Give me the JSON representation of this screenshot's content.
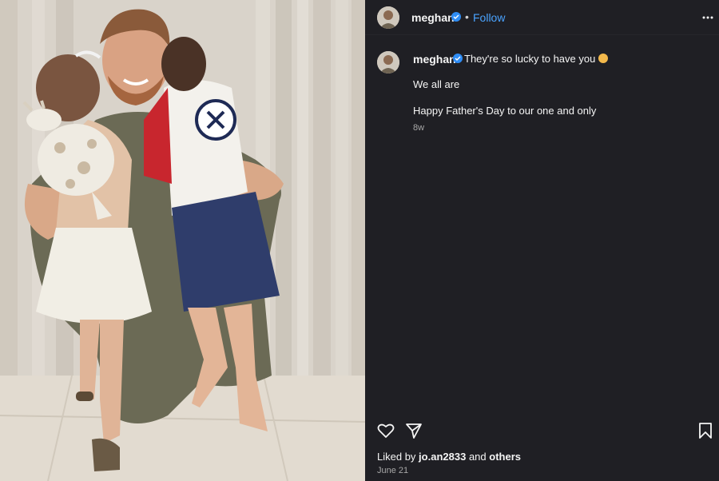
{
  "post": {
    "username": "meghan",
    "follow_label": "Follow",
    "dot_separator": "•",
    "caption_first": "They're so lucky to have you",
    "caption_line_2": "We all are",
    "caption_line_3": "Happy Father's Day to our one and only",
    "age": "8w",
    "liked_by_prefix": "Liked by",
    "liked_by_user": "jo.an2833",
    "liked_by_and": "and",
    "liked_by_others": "others",
    "date": "June 21"
  },
  "colors": {
    "panel_bg": "#1f1f24",
    "link_blue": "#4aa3ff",
    "verified_blue": "#2f8df5"
  },
  "icons": {
    "header_more": "more-horizontal-icon",
    "like": "heart-icon",
    "share": "paper-plane-icon",
    "save": "bookmark-icon",
    "verified": "verified-badge-icon",
    "emoji": "pleading-face-emoji"
  }
}
